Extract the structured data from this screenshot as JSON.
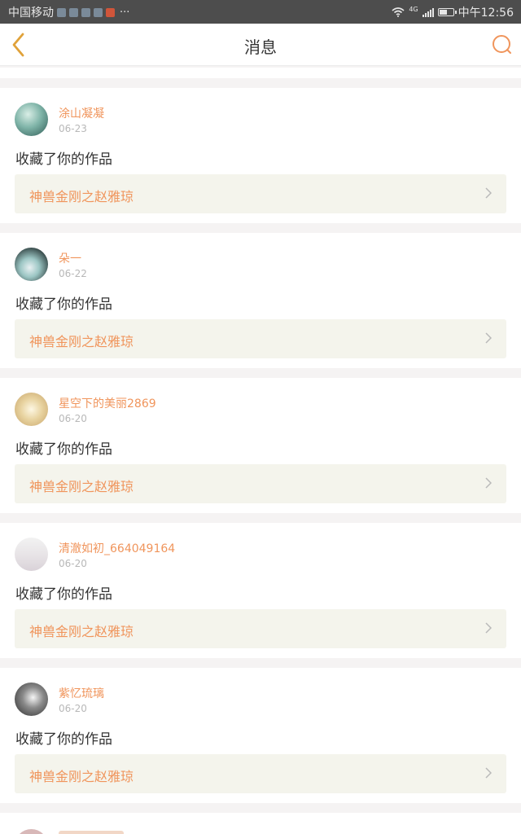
{
  "status_bar": {
    "carrier": "中国移动",
    "more": "···",
    "network": "4G",
    "time": "中午12:56",
    "battery_level": 0.5
  },
  "nav": {
    "title": "消息",
    "back_icon": "chevron-left-icon",
    "search_icon": "search-icon"
  },
  "colors": {
    "accent": "#f0955c",
    "back_icon": "#e0a23a",
    "link_bg": "#f4f4ec"
  },
  "notifications": [
    {
      "user": "涂山凝凝",
      "date": "06-23",
      "action": "收藏了你的作品",
      "work": "神兽金刚之赵雅琼"
    },
    {
      "user": "朵一",
      "date": "06-22",
      "action": "收藏了你的作品",
      "work": "神兽金刚之赵雅琼"
    },
    {
      "user": "星空下的美丽2869",
      "date": "06-20",
      "action": "收藏了你的作品",
      "work": "神兽金刚之赵雅琼"
    },
    {
      "user": "清澈如初_664049164",
      "date": "06-20",
      "action": "收藏了你的作品",
      "work": "神兽金刚之赵雅琼"
    },
    {
      "user": "紫忆琉璃",
      "date": "06-20",
      "action": "收藏了你的作品",
      "work": "神兽金刚之赵雅琼"
    }
  ]
}
